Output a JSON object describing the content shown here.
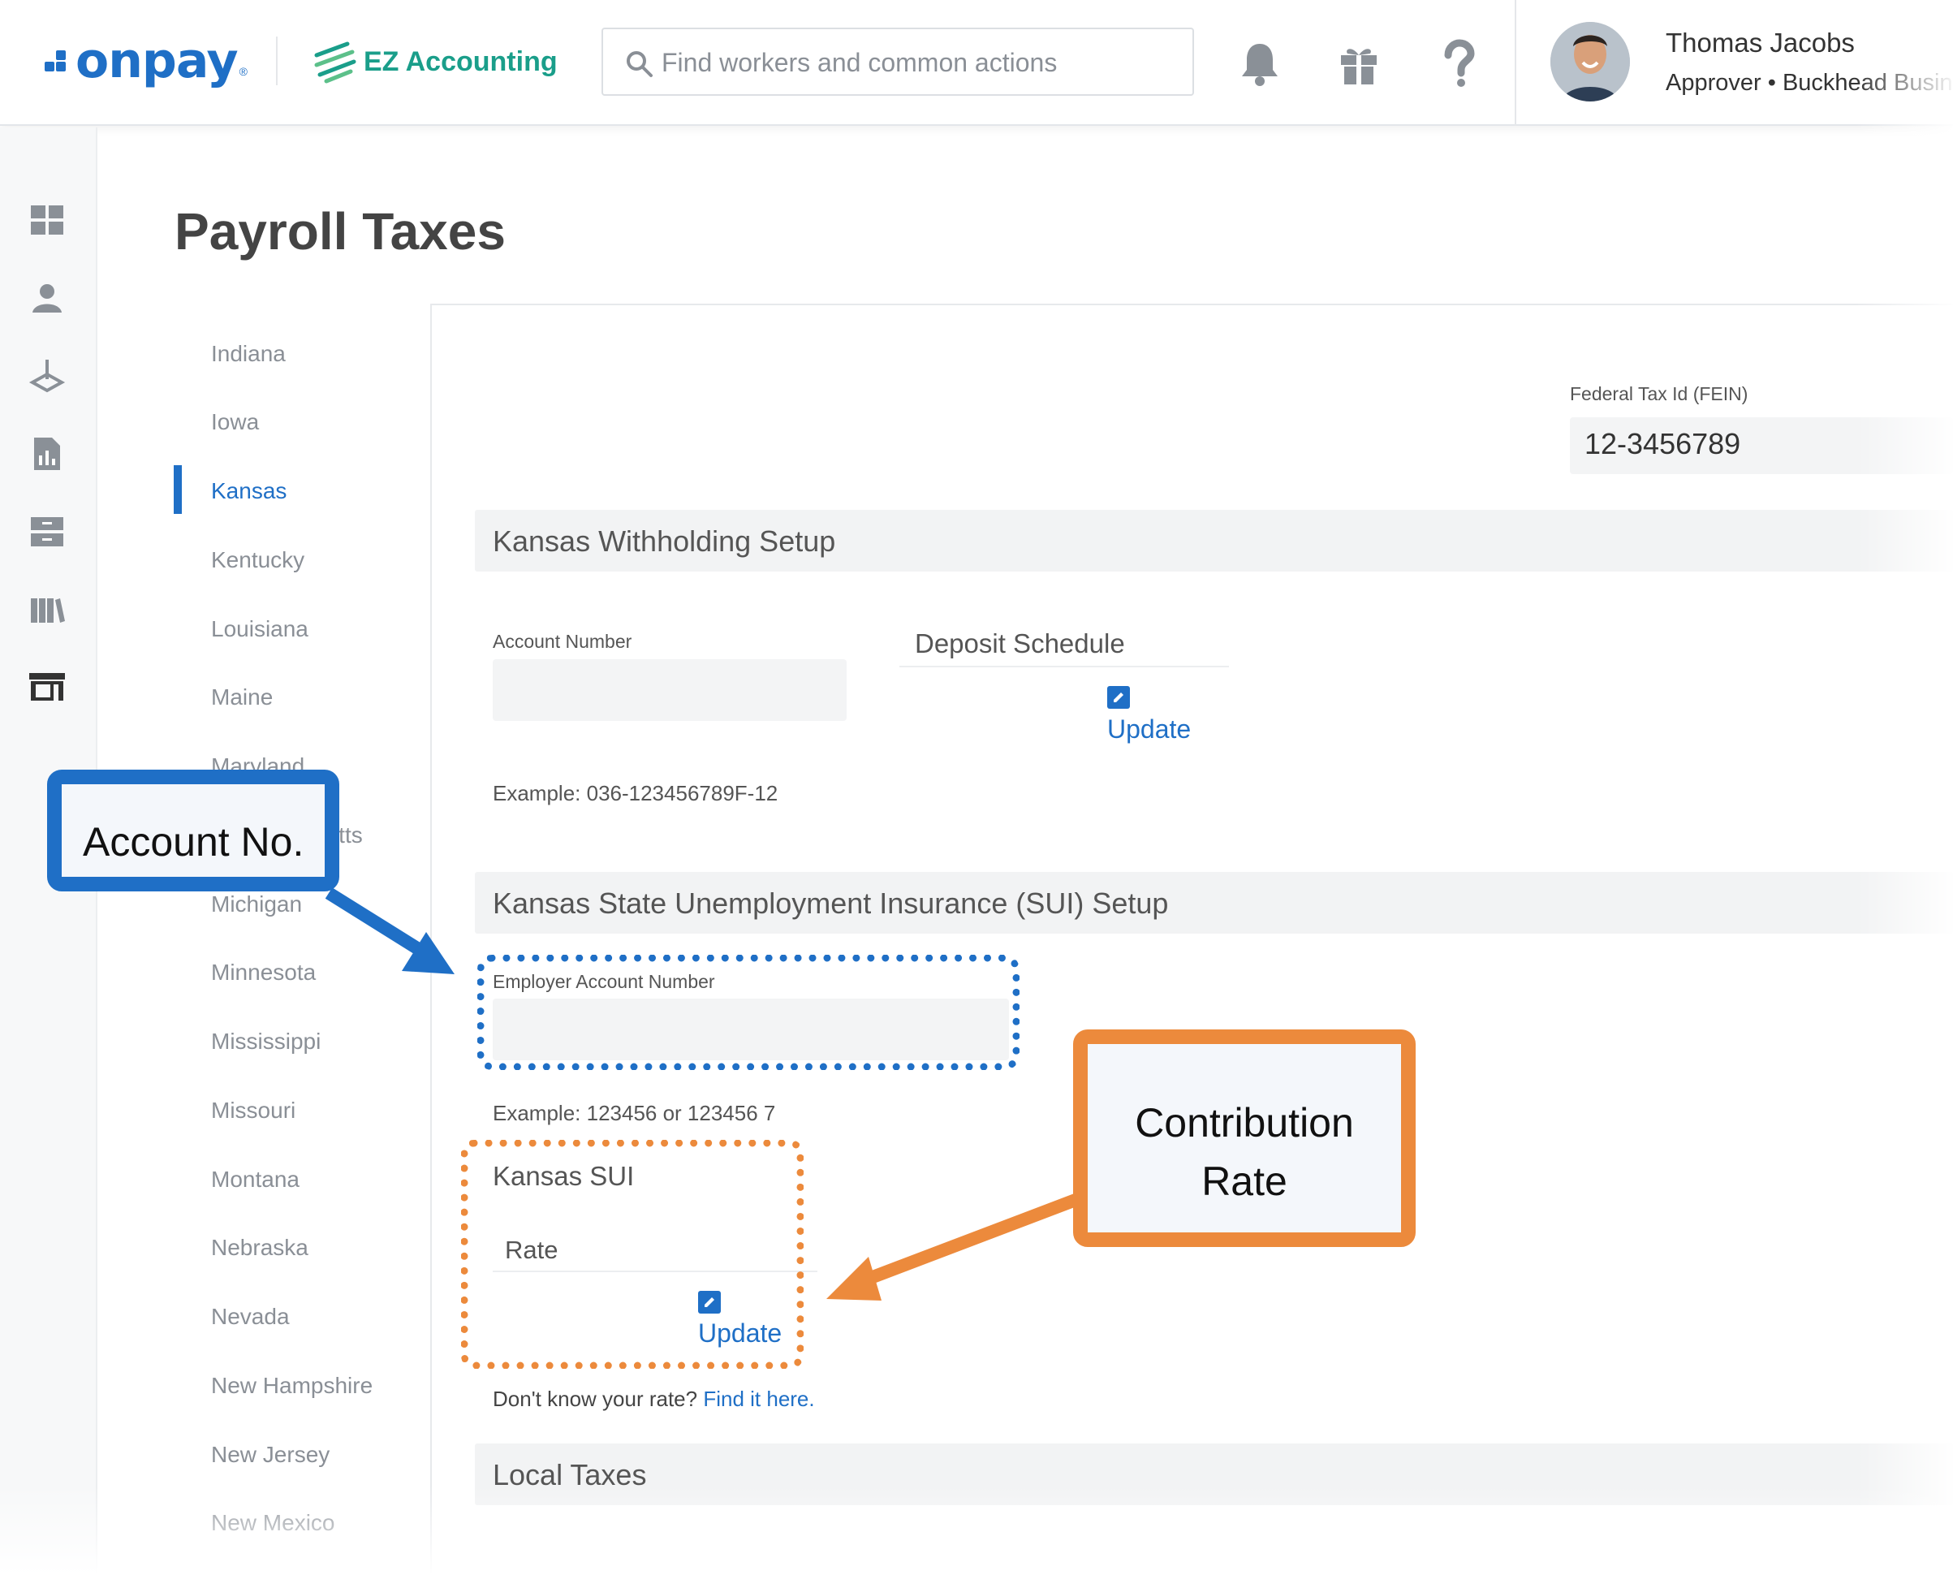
{
  "header": {
    "brand": "onpay",
    "brand_mark": "®",
    "partner": "EZ Accounting",
    "search_placeholder": "Find workers and common actions",
    "icons": [
      "bell-icon",
      "gift-icon",
      "help-icon"
    ],
    "user": {
      "name": "Thomas Jacobs",
      "role": "Approver • Buckhead Busin"
    }
  },
  "rail": {
    "icons": [
      "dashboard-icon",
      "people-icon",
      "payroll-icon",
      "reports-icon",
      "files-icon",
      "library-icon",
      "store-icon"
    ]
  },
  "page": {
    "title": "Payroll Taxes"
  },
  "states": {
    "items": [
      "Indiana",
      "Iowa",
      "Kansas",
      "Kentucky",
      "Louisiana",
      "Maine",
      "Maryland",
      "Massachusetts",
      "Michigan",
      "Minnesota",
      "Mississippi",
      "Missouri",
      "Montana",
      "Nebraska",
      "Nevada",
      "New Hampshire",
      "New Jersey",
      "New Mexico"
    ],
    "active": "Kansas"
  },
  "fein": {
    "label": "Federal Tax Id (FEIN)",
    "value": "12-3456789"
  },
  "withholding": {
    "title": "Kansas Withholding Setup",
    "account_label": "Account Number",
    "account_value": "",
    "deposit_label": "Deposit Schedule",
    "update_label": "Update",
    "example": "Example: 036-123456789F-12"
  },
  "sui": {
    "title": "Kansas State Unemployment Insurance (SUI) Setup",
    "employer_label": "Employer Account Number",
    "employer_value": "",
    "example": "Example: 123456 or 123456 7",
    "sub_title": "Kansas SUI",
    "rate_label": "Rate",
    "update_label": "Update",
    "help_prefix": "Don't know your rate?",
    "help_link": "Find it here."
  },
  "local": {
    "title": "Local Taxes"
  },
  "callouts": {
    "account": "Account No.",
    "contribution_line1": "Contribution",
    "contribution_line2": "Rate"
  },
  "colors": {
    "brand_blue": "#1f6fc6",
    "ez_green": "#1a9e8a",
    "callout_orange": "#ec8a3c"
  }
}
